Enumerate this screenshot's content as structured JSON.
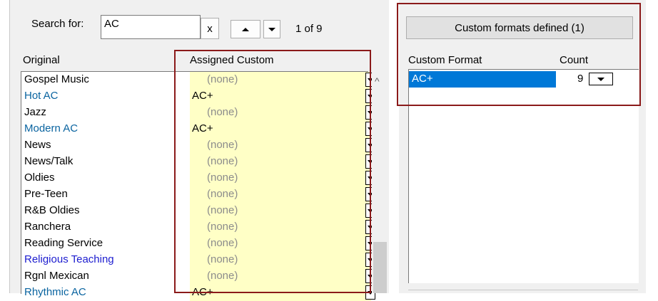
{
  "search": {
    "label": "Search for:",
    "value": "AC",
    "clear_label": "x",
    "match_count": "1 of 9"
  },
  "columns": {
    "original": "Original",
    "assigned": "Assigned Custom"
  },
  "rows": [
    {
      "original": "Gospel Music",
      "assigned": "(none)",
      "color": "#000000"
    },
    {
      "original": "Hot AC",
      "assigned": "AC+",
      "color": "#0a64a0"
    },
    {
      "original": "Jazz",
      "assigned": "(none)",
      "color": "#000000"
    },
    {
      "original": "Modern AC",
      "assigned": "AC+",
      "color": "#0a64a0"
    },
    {
      "original": "News",
      "assigned": "(none)",
      "color": "#000000"
    },
    {
      "original": "News/Talk",
      "assigned": "(none)",
      "color": "#000000"
    },
    {
      "original": "Oldies",
      "assigned": "(none)",
      "color": "#000000"
    },
    {
      "original": "Pre-Teen",
      "assigned": "(none)",
      "color": "#000000"
    },
    {
      "original": "R&B Oldies",
      "assigned": "(none)",
      "color": "#000000"
    },
    {
      "original": "Ranchera",
      "assigned": "(none)",
      "color": "#000000"
    },
    {
      "original": "Reading Service",
      "assigned": "(none)",
      "color": "#000000"
    },
    {
      "original": "Religious Teaching",
      "assigned": "(none)",
      "color": "#1c1ccf"
    },
    {
      "original": "Rgnl Mexican",
      "assigned": "(none)",
      "color": "#000000"
    },
    {
      "original": "Rhythmic AC",
      "assigned": "AC+",
      "color": "#0a64a0"
    }
  ],
  "custom_formats": {
    "defined_label": "Custom formats defined (1)",
    "header_format": "Custom Format",
    "header_count": "Count",
    "items": [
      {
        "name": "AC+",
        "count": "9"
      }
    ]
  },
  "colors": {
    "assigned_bg": "#ffffc6",
    "selection": "#0078d7",
    "highlight_box": "#8b1a1a"
  }
}
